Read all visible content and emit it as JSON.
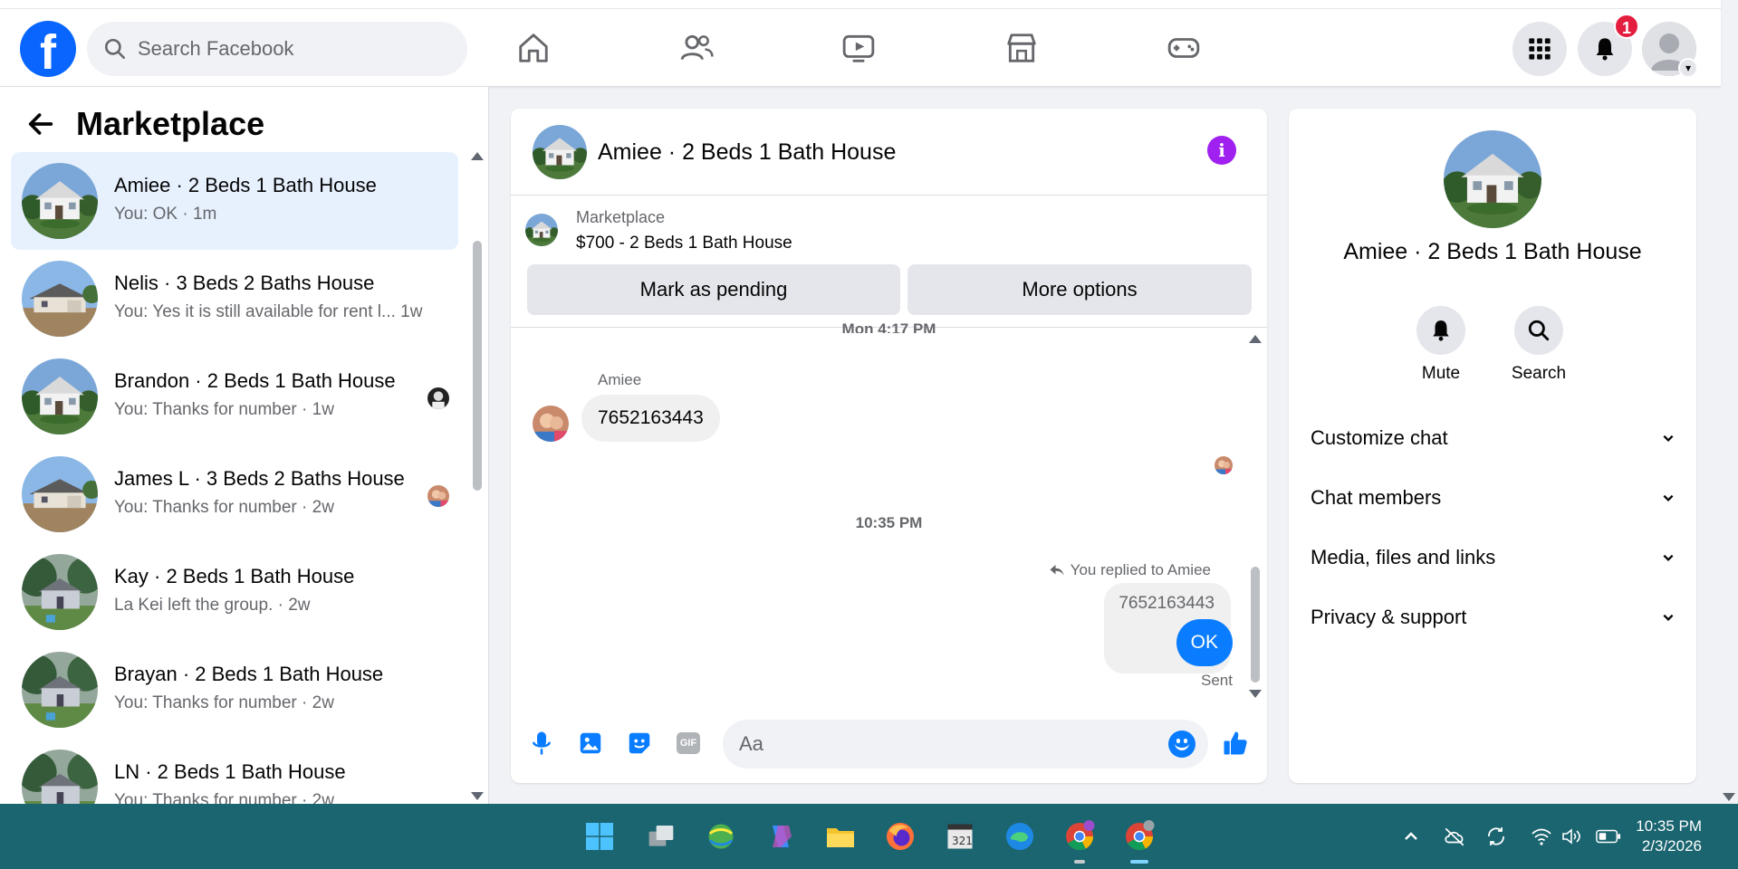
{
  "nav": {
    "search_placeholder": "Search Facebook",
    "notification_count": "1",
    "brand_color": "#0866ff"
  },
  "left": {
    "title": "Marketplace",
    "conversations": [
      {
        "name": "Amiee · 2 Beds 1 Bath House",
        "preview": "You: OK · 1m",
        "active": true
      },
      {
        "name": "Nelis · 3 Beds 2 Baths House",
        "preview": "You: Yes it is still available for rent l...   1w",
        "active": false
      },
      {
        "name": "Brandon · 2 Beds 1 Bath House",
        "preview": "You: Thanks for number · 1w",
        "active": false
      },
      {
        "name": "James L · 3 Beds 2 Baths House",
        "preview": "You: Thanks for number · 2w",
        "active": false
      },
      {
        "name": "Kay · 2 Beds 1 Bath House",
        "preview": "La Kei left the group. · 2w",
        "active": false
      },
      {
        "name": "Brayan · 2 Beds 1 Bath House",
        "preview": "You: Thanks for number · 2w",
        "active": false
      },
      {
        "name": "LN · 2 Beds 1 Bath House",
        "preview": "You: Thanks for number · 2w",
        "active": false
      }
    ]
  },
  "chat": {
    "title": "Amiee · 2 Beds 1 Bath House",
    "listing_source": "Marketplace",
    "listing_title": "$700 - 2 Beds 1 Bath House",
    "mark_pending_label": "Mark as pending",
    "more_options_label": "More options",
    "timestamp_1": "Mon 4:17 PM",
    "sender_name": "Amiee",
    "incoming_message": "7652163443",
    "timestamp_2": "10:35 PM",
    "reply_note": "You replied to Amiee",
    "quoted_message": "7652163443",
    "outgoing_message": "OK",
    "status": "Sent",
    "composer_placeholder": "Aa",
    "gif_label": "GIF",
    "outgoing_color": "#0a7cff"
  },
  "details": {
    "name": "Amiee · 2 Beds 1 Bath House",
    "actions": [
      {
        "label": "Mute",
        "icon": "bell-icon"
      },
      {
        "label": "Search",
        "icon": "search-icon"
      }
    ],
    "sections": [
      "Customize chat",
      "Chat members",
      "Media, files and links",
      "Privacy & support"
    ]
  },
  "taskbar": {
    "time": "10:35 PM",
    "date": "2/3/2026",
    "color": "#1b6570"
  }
}
